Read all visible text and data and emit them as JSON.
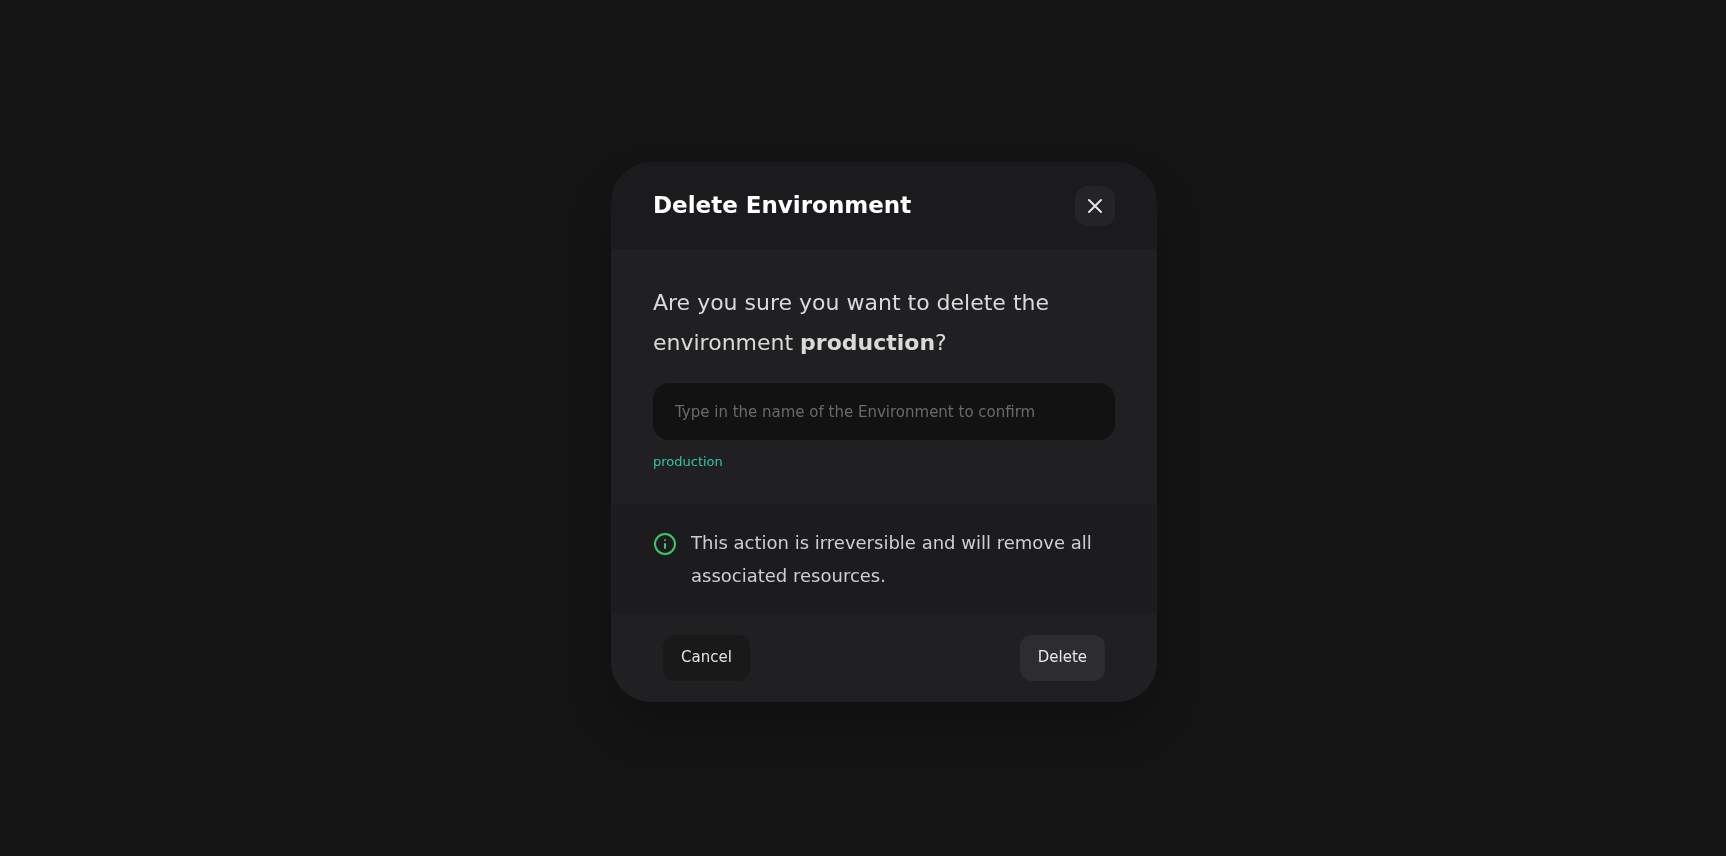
{
  "dialog": {
    "title": "Delete Environment",
    "message": "Are you sure you want to delete the environment **production**?",
    "confirm_field": {
      "placeholder": "Type in the name of the Environment to confirm"
    },
    "hint": "production",
    "notice": "This action is irreversible and will remove all associated resources.",
    "buttons": [
      {
        "label": "Cancel",
        "kind": "secondary"
      },
      {
        "label": "Delete",
        "kind": "primary"
      }
    ]
  }
}
